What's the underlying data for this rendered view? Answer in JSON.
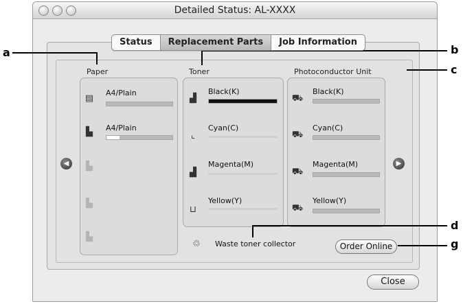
{
  "window": {
    "title": "Detailed Status: AL-XXXX"
  },
  "tabs": [
    {
      "label": "Status"
    },
    {
      "label": "Replacement Parts"
    },
    {
      "label": "Job Information"
    }
  ],
  "active_tab": "Replacement Parts",
  "paper": {
    "label": "Paper",
    "trays": [
      {
        "label": "A4/Plain",
        "icon": "paper-tray-mp-icon",
        "level": 0.0
      },
      {
        "label": "A4/Plain",
        "icon": "paper-tray-1-icon",
        "level": 0.2
      },
      {
        "label": "",
        "icon": "paper-tray-2-icon"
      },
      {
        "label": "",
        "icon": "paper-tray-3-icon"
      },
      {
        "label": "",
        "icon": "paper-tray-4-icon"
      }
    ]
  },
  "toner": {
    "label": "Toner",
    "items": [
      {
        "label": "Black(K)",
        "level": 1.0,
        "color": "#111111"
      },
      {
        "label": "Cyan(C)",
        "level": 0.0
      },
      {
        "label": "Magenta(M)",
        "level": 0.0
      },
      {
        "label": "Yellow(Y)",
        "level": 0.0
      }
    ]
  },
  "photoconductor": {
    "label": "Photoconductor Unit",
    "items": [
      {
        "label": "Black(K)"
      },
      {
        "label": "Cyan(C)"
      },
      {
        "label": "Magenta(M)"
      },
      {
        "label": "Yellow(Y)"
      }
    ]
  },
  "waste_toner": {
    "label": "Waste toner collector"
  },
  "buttons": {
    "order_online": "Order Online",
    "close": "Close"
  },
  "callouts": {
    "a": "a",
    "b": "b",
    "c": "c",
    "d": "d",
    "g": "g"
  }
}
